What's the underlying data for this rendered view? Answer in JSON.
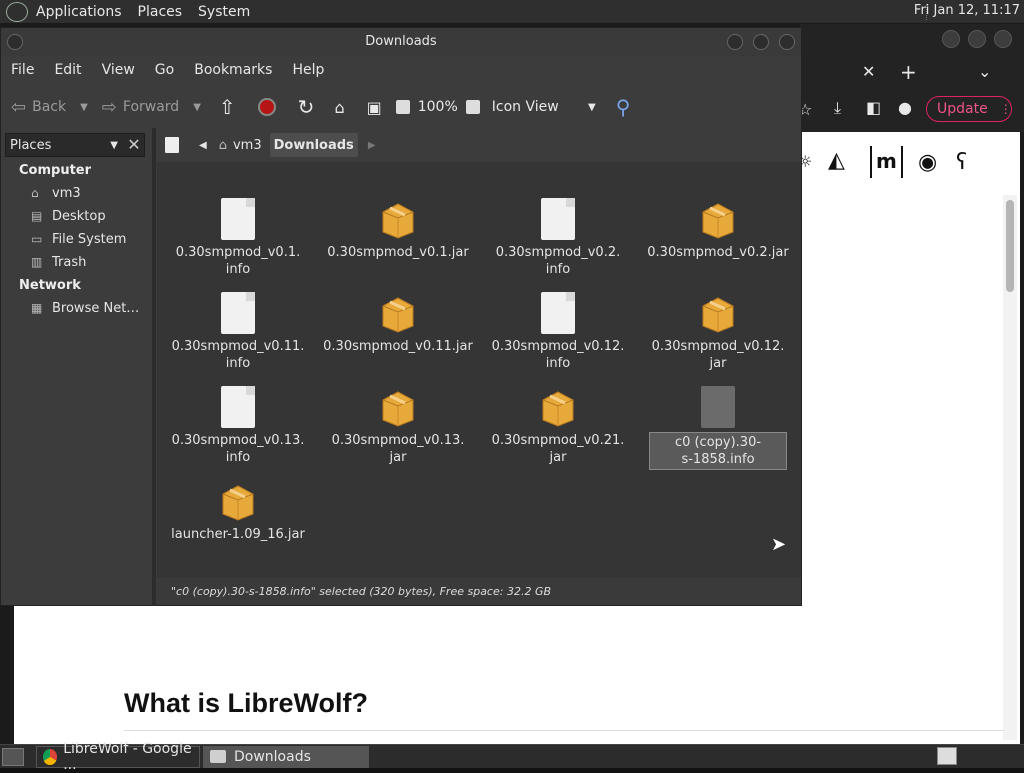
{
  "top_panel": {
    "menus": [
      "Applications",
      "Places",
      "System"
    ],
    "clock": "Fri Jan 12, 11:17"
  },
  "browser": {
    "update_label": "Update",
    "heading": "What is LibreWolf?",
    "toolbar_icons": [
      "close-icon",
      "plus-icon",
      "chevron-down-icon",
      "download-icon",
      "sidebar-icon",
      "account-icon",
      "menu-icon"
    ],
    "site_icons": [
      "settings-icon",
      "lemmy-icon",
      "matrix-icon",
      "reddit-icon",
      "bear-icon"
    ]
  },
  "file_manager": {
    "title": "Downloads",
    "menu": [
      "File",
      "Edit",
      "View",
      "Go",
      "Bookmarks",
      "Help"
    ],
    "toolbar": {
      "back": "Back",
      "forward": "Forward",
      "zoom": "100%",
      "view_mode": "Icon View"
    },
    "sidebar": {
      "header": "Places",
      "sections": [
        {
          "title": "Computer",
          "items": [
            {
              "label": "vm3",
              "icon": "home-icon"
            },
            {
              "label": "Desktop",
              "icon": "desktop-icon"
            },
            {
              "label": "File System",
              "icon": "drive-icon"
            },
            {
              "label": "Trash",
              "icon": "trash-icon"
            }
          ]
        },
        {
          "title": "Network",
          "items": [
            {
              "label": "Browse Net…",
              "icon": "network-icon"
            }
          ]
        }
      ]
    },
    "path": [
      "vm3",
      "Downloads"
    ],
    "files": [
      {
        "name": "0.30smpmod_v0.1.\ninfo",
        "type": "info"
      },
      {
        "name": "0.30smpmod_v0.1.jar",
        "type": "jar"
      },
      {
        "name": "0.30smpmod_v0.2.\ninfo",
        "type": "info"
      },
      {
        "name": "0.30smpmod_v0.2.jar",
        "type": "jar"
      },
      {
        "name": "0.30smpmod_v0.11.\ninfo",
        "type": "info"
      },
      {
        "name": "0.30smpmod_v0.11.jar",
        "type": "jar"
      },
      {
        "name": "0.30smpmod_v0.12.\ninfo",
        "type": "info"
      },
      {
        "name": "0.30smpmod_v0.12.\njar",
        "type": "jar"
      },
      {
        "name": "0.30smpmod_v0.13.\ninfo",
        "type": "info"
      },
      {
        "name": "0.30smpmod_v0.13.\njar",
        "type": "jar"
      },
      {
        "name": "0.30smpmod_v0.21.\njar",
        "type": "jar"
      },
      {
        "name": "c0 (copy).30-\ns-1858.info",
        "type": "generic",
        "selected": true
      },
      {
        "name": "launcher-1.09_16.jar",
        "type": "jar"
      }
    ],
    "status": "\"c0 (copy).30-s-1858.info\" selected (320 bytes), Free space: 32.2 GB"
  },
  "taskbar": {
    "tasks": [
      {
        "label": "LibreWolf - Google ...",
        "icon": "chrome-icon",
        "active": false
      },
      {
        "label": "Downloads",
        "icon": "folder-icon",
        "active": true
      }
    ]
  }
}
